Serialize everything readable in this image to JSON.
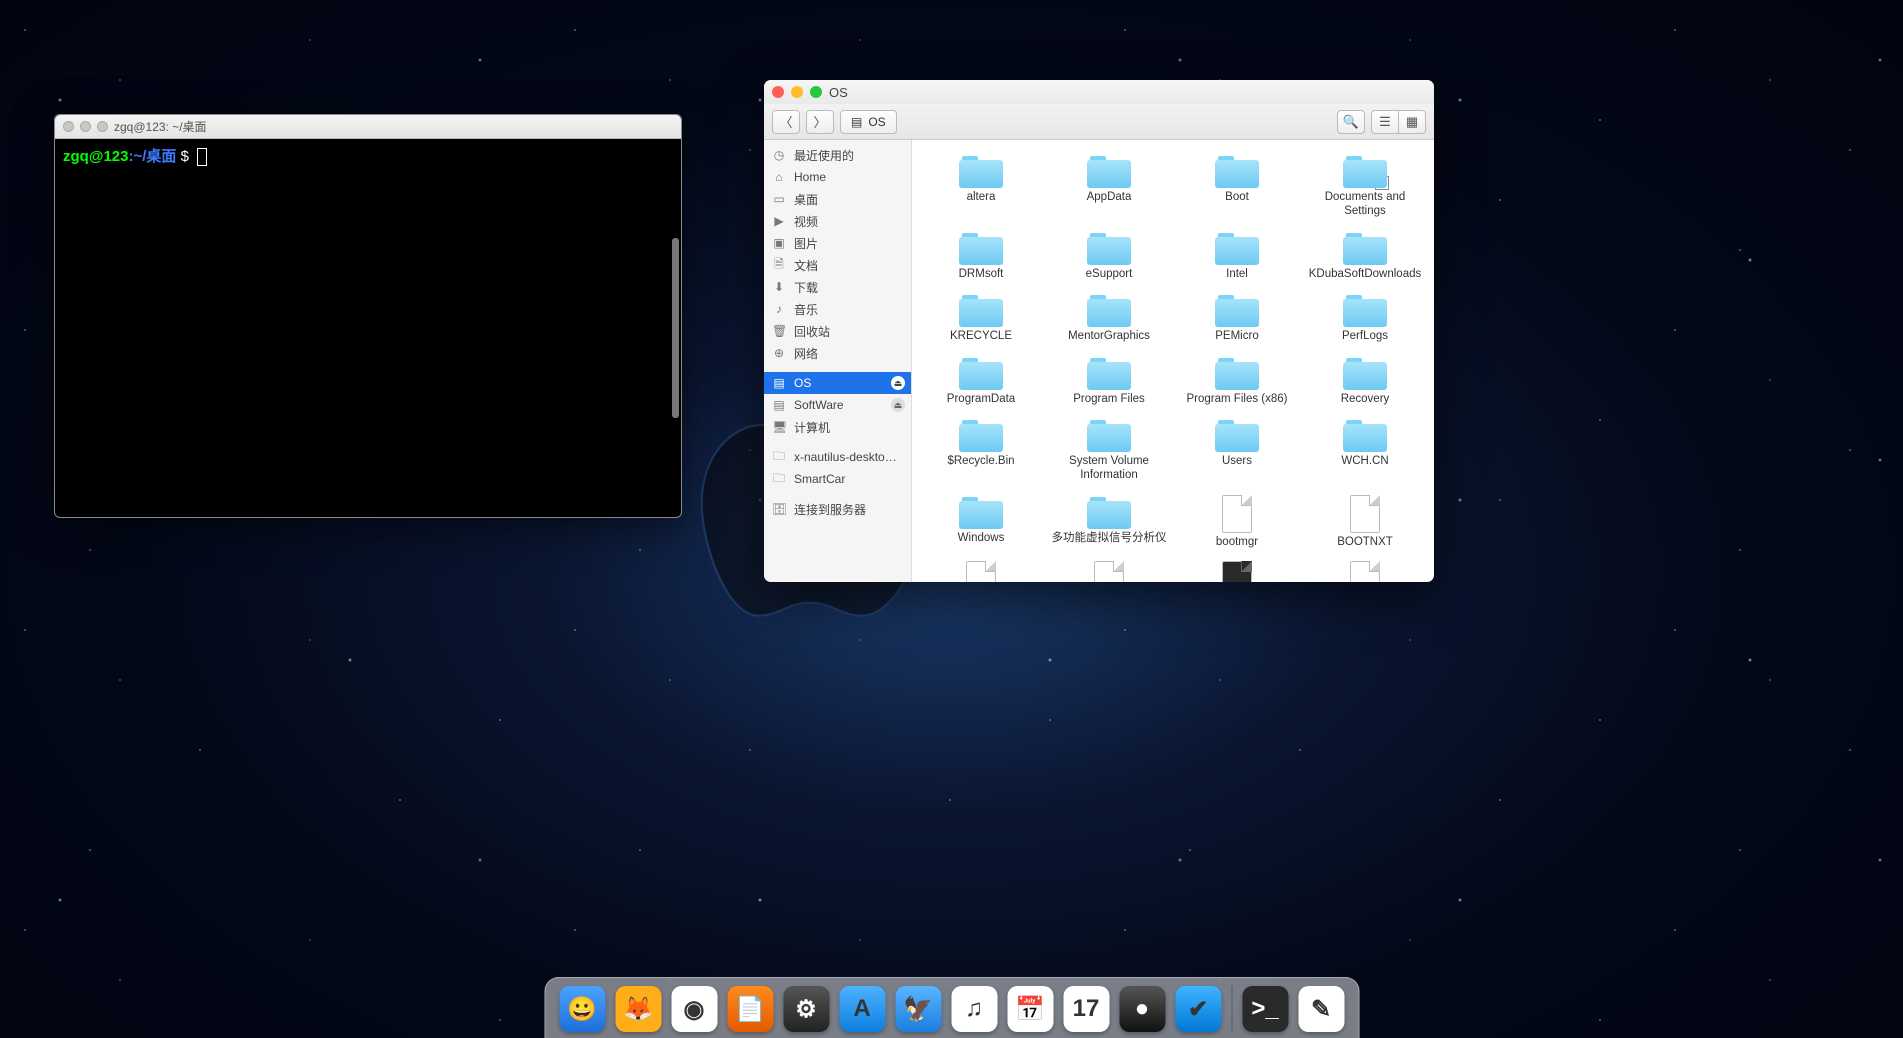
{
  "terminal": {
    "title": "zgq@123: ~/桌面",
    "prompt_user": "zgq@123",
    "prompt_sep": ":",
    "prompt_path": "~/桌面",
    "prompt_symbol": "$"
  },
  "fm": {
    "title": "OS",
    "breadcrumb": "OS",
    "sidebar": [
      {
        "icon": "clock",
        "label": "最近使用的"
      },
      {
        "icon": "home",
        "label": "Home"
      },
      {
        "icon": "desktop",
        "label": "桌面"
      },
      {
        "icon": "video",
        "label": "视频"
      },
      {
        "icon": "image",
        "label": "图片"
      },
      {
        "icon": "doc",
        "label": "文档"
      },
      {
        "icon": "download",
        "label": "下载"
      },
      {
        "icon": "music",
        "label": "音乐"
      },
      {
        "icon": "trash",
        "label": "回收站"
      },
      {
        "icon": "network",
        "label": "网络"
      },
      {
        "icon": "disk",
        "label": "OS",
        "active": true,
        "eject": true
      },
      {
        "icon": "disk",
        "label": "SoftWare",
        "eject": true
      },
      {
        "icon": "computer",
        "label": "计算机"
      },
      {
        "icon": "folder",
        "label": "x-nautilus-deskto…"
      },
      {
        "icon": "folder",
        "label": "SmartCar"
      },
      {
        "icon": "server",
        "label": "连接到服务器"
      }
    ],
    "items": [
      {
        "type": "folder",
        "label": "altera"
      },
      {
        "type": "folder",
        "label": "AppData"
      },
      {
        "type": "folder",
        "label": "Boot"
      },
      {
        "type": "folder",
        "label": "Documents and Settings",
        "shortcut": true
      },
      {
        "type": "folder",
        "label": "DRMsoft"
      },
      {
        "type": "folder",
        "label": "eSupport"
      },
      {
        "type": "folder",
        "label": "Intel"
      },
      {
        "type": "folder",
        "label": "KDubaSoftDownloads"
      },
      {
        "type": "folder",
        "label": "KRECYCLE"
      },
      {
        "type": "folder",
        "label": "MentorGraphics"
      },
      {
        "type": "folder",
        "label": "PEMicro"
      },
      {
        "type": "folder",
        "label": "PerfLogs"
      },
      {
        "type": "folder",
        "label": "ProgramData"
      },
      {
        "type": "folder",
        "label": "Program Files"
      },
      {
        "type": "folder",
        "label": "Program Files (x86)"
      },
      {
        "type": "folder",
        "label": "Recovery"
      },
      {
        "type": "folder",
        "label": "$Recycle.Bin"
      },
      {
        "type": "folder",
        "label": "System Volume Information"
      },
      {
        "type": "folder",
        "label": "Users"
      },
      {
        "type": "folder",
        "label": "WCH.CN"
      },
      {
        "type": "folder",
        "label": "Windows"
      },
      {
        "type": "folder",
        "label": "多功能虚拟信号分析仪"
      },
      {
        "type": "file",
        "label": "bootmgr"
      },
      {
        "type": "file",
        "label": "BOOTNXT"
      },
      {
        "type": "file",
        "label": ""
      },
      {
        "type": "file",
        "label": ""
      },
      {
        "type": "file-dark",
        "label": ""
      },
      {
        "type": "file",
        "label": ""
      }
    ]
  },
  "dock": {
    "items": [
      {
        "id": "finder",
        "glyph": "😀"
      },
      {
        "id": "firefox",
        "glyph": "🦊"
      },
      {
        "id": "chrome",
        "glyph": "◉"
      },
      {
        "id": "pdf",
        "glyph": "📄"
      },
      {
        "id": "settings",
        "glyph": "⚙"
      },
      {
        "id": "appstore",
        "glyph": "A"
      },
      {
        "id": "mail",
        "glyph": "🦅"
      },
      {
        "id": "music",
        "glyph": "♫"
      },
      {
        "id": "ical",
        "glyph": "📅"
      },
      {
        "id": "calendar",
        "glyph": "17"
      },
      {
        "id": "quicktime",
        "glyph": "●"
      },
      {
        "id": "clean",
        "glyph": "✔"
      },
      {
        "id": "terminal",
        "glyph": ">_"
      },
      {
        "id": "textedit",
        "glyph": "✎"
      }
    ]
  }
}
